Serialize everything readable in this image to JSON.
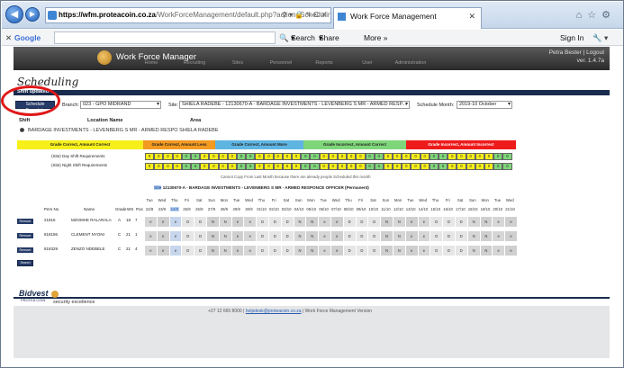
{
  "browser": {
    "url_host": "https://wfm.proteacoin.co.za",
    "url_rest": "/WorkForceManagement/default.php?action=Scheduling#",
    "tab_title": "Work Force Management",
    "addr_tools": "⚲ ▾ 🔒 ✎ C ✕"
  },
  "google_bar": {
    "logo": "Google",
    "search_label": "Search",
    "share_label": "Share",
    "more_label": "More »",
    "signin": "Sign In"
  },
  "app": {
    "title": "Work Force Manager",
    "user_line1": "Petra Bester | Logout",
    "user_line2": "ver. 1.4.7a",
    "modules": [
      "Home",
      "Recruiting",
      "Sites",
      "Personnel",
      "Reports",
      "User",
      "Administration"
    ]
  },
  "page": {
    "title": "Scheduling",
    "status": "Shift updated",
    "schedule_complete": "Schedule Complete",
    "branch_label": "Branch:",
    "branch_value": "023 - GPO MIDRAND",
    "site_label": "Site:",
    "site_value": "SHIELA RADEBE - 12130670-A - BARDAGE INVESTMENTS - LEVENBERG S MR - ARMED RESP...",
    "month_label": "Schedule Month:",
    "month_value": "2019-10 October",
    "col_shift": "Shift",
    "col_location": "Location Name",
    "col_area": "Area",
    "location_row": "BARDAGE INVESTMENTS - LEVENBERG S MR - ARMED RESPO SHIELA RADEBE"
  },
  "legend": [
    {
      "label": "Grade Correct, Amount Correct",
      "color": "#f7ef1a"
    },
    {
      "label": "Grade Correct, Amount Less",
      "color": "#f39a21"
    },
    {
      "label": "Grade Correct, Amount More",
      "color": "#5fb5e2"
    },
    {
      "label": "Grade Incorrect, Amount Correct",
      "color": "#7fd67a"
    },
    {
      "label": "Grade Incorrect, Amount Incorrect",
      "color": "#ee1b1b"
    }
  ],
  "requirements": {
    "day_label": "(Site) Day Shift Requirements",
    "night_label": "(Site) Night Shift Requirements",
    "day_values": [
      "0",
      "0",
      "0",
      "0",
      "0",
      "0",
      "0",
      "0",
      "0",
      "0",
      "0",
      "0",
      "0",
      "0",
      "0",
      "0",
      "0",
      "0",
      "0",
      "0",
      "0",
      "0",
      "0",
      "0",
      "0",
      "0",
      "0",
      "0",
      "0",
      "0",
      "0",
      "0",
      "0",
      "0",
      "0",
      "0",
      "0",
      "0",
      "0",
      "0",
      "0"
    ],
    "night_values": [
      "0",
      "0",
      "0",
      "0",
      "0",
      "0",
      "0",
      "0",
      "0",
      "0",
      "0",
      "0",
      "0",
      "0",
      "0",
      "0",
      "0",
      "0",
      "0",
      "0",
      "0",
      "0",
      "0",
      "0",
      "0",
      "0",
      "0",
      "0",
      "0",
      "0",
      "0",
      "0",
      "0",
      "0",
      "0",
      "0",
      "0",
      "0",
      "0",
      "0",
      "0"
    ],
    "day_colors": [
      "#f7ef1a",
      "#f7ef1a",
      "#f7ef1a",
      "#f7ef1a",
      "#7fd67a",
      "#7fd67a",
      "#f7ef1a",
      "#f7ef1a",
      "#f7ef1a",
      "#f7ef1a",
      "#7fd67a",
      "#7fd67a",
      "#f7ef1a",
      "#f7ef1a",
      "#f7ef1a",
      "#f7ef1a",
      "#f7ef1a",
      "#7fd67a",
      "#7fd67a",
      "#f7ef1a",
      "#f7ef1a",
      "#f7ef1a",
      "#f7ef1a",
      "#f7ef1a",
      "#7fd67a",
      "#7fd67a",
      "#f7ef1a",
      "#f7ef1a",
      "#f7ef1a",
      "#f7ef1a",
      "#f7ef1a",
      "#7fd67a",
      "#7fd67a",
      "#f7ef1a",
      "#f7ef1a",
      "#f7ef1a",
      "#f7ef1a",
      "#f7ef1a",
      "#7fd67a",
      "#7fd67a",
      "#f7ef1a"
    ]
  },
  "note": "Cannot Copy From Last Month because there are already people Scheduled this month",
  "site_heading_link": "Site",
  "site_heading": " 12130670-A - BARDAGE INVESTMENTS - LEVENBERG S MR - ARMED RESPONCE OFFICER (Permanent)",
  "grid_headers": {
    "pers_no": "Pers No",
    "name": "Name",
    "grade": "Grade",
    "ws": "WS",
    "pos": "Pos",
    "days": [
      "Tue",
      "Wed",
      "Thu",
      "Fri",
      "Sat",
      "Sun",
      "Mon",
      "Tue",
      "Wed",
      "Thu",
      "Fri",
      "Sat",
      "Sun",
      "Mon",
      "Tue",
      "Wed",
      "Thu",
      "Fri",
      "Sat",
      "Sun",
      "Mon",
      "Tue",
      "Wed",
      "Thu",
      "Fri",
      "Sat",
      "Sun",
      "Mon",
      "Tue",
      "Wed",
      "Thu",
      "Fri",
      "Sat",
      "Sun",
      "Mon",
      "Tue",
      "Wed",
      "Thu",
      "Fri",
      "Sat",
      "Sun",
      "Mon",
      "Tue",
      "Wed"
    ],
    "dates": [
      "22/8",
      "23/9",
      "24/9",
      "25/9",
      "26/9",
      "27/9",
      "28/9",
      "29/9",
      "30/9",
      "01/10",
      "02/10",
      "03/10",
      "04/10",
      "05/10",
      "06/10",
      "07/10",
      "08/10",
      "09/10",
      "10/10",
      "11/10",
      "12/10",
      "13/10",
      "14/10",
      "15/10",
      "16/10",
      "17/10",
      "18/10",
      "19/10",
      "20/10",
      "21/10"
    ]
  },
  "employees": [
    {
      "remove": "Remove",
      "pers_no": "21816",
      "name": "MZOMHE RALARALA",
      "grade": "A",
      "ws": "18",
      "pos": "7",
      "shifts": [
        "e",
        "e",
        "e",
        "D",
        "D",
        "N",
        "N",
        "e",
        "e",
        "D",
        "D",
        "D",
        "N",
        "N",
        "e",
        "e",
        "D",
        "D",
        "D",
        "N",
        "N",
        "e",
        "e",
        "D",
        "D",
        "D",
        "N",
        "N",
        "e",
        "e"
      ]
    },
    {
      "remove": "Remove",
      "pers_no": "818186",
      "name": "CLEMENT NYONI",
      "grade": "C",
      "ws": "21",
      "pos": "1",
      "shifts": [
        "e",
        "e",
        "e",
        "D",
        "D",
        "N",
        "N",
        "e",
        "e",
        "D",
        "D",
        "D",
        "N",
        "N",
        "e",
        "e",
        "D",
        "D",
        "D",
        "N",
        "N",
        "e",
        "e",
        "D",
        "D",
        "D",
        "N",
        "N",
        "e",
        "e"
      ]
    },
    {
      "remove": "Remove",
      "pers_no": "818329",
      "name": "ZENZO NDEBELE",
      "grade": "C",
      "ws": "21",
      "pos": "4",
      "shifts": [
        "e",
        "e",
        "e",
        "D",
        "D",
        "N",
        "N",
        "e",
        "e",
        "D",
        "D",
        "D",
        "N",
        "N",
        "e",
        "e",
        "D",
        "D",
        "D",
        "N",
        "N",
        "e",
        "e",
        "D",
        "D",
        "D",
        "N",
        "N",
        "e",
        "e"
      ]
    }
  ],
  "search_btn": "Search",
  "footer": {
    "brand": "Bidvest",
    "brand_sub": "PROTEA COIN",
    "tagline": "security excellence",
    "phone": "+27 12 665 8000 |",
    "email": "helpdesk@proteacoin.co.za",
    "suffix": "| Work Force Management Version"
  }
}
